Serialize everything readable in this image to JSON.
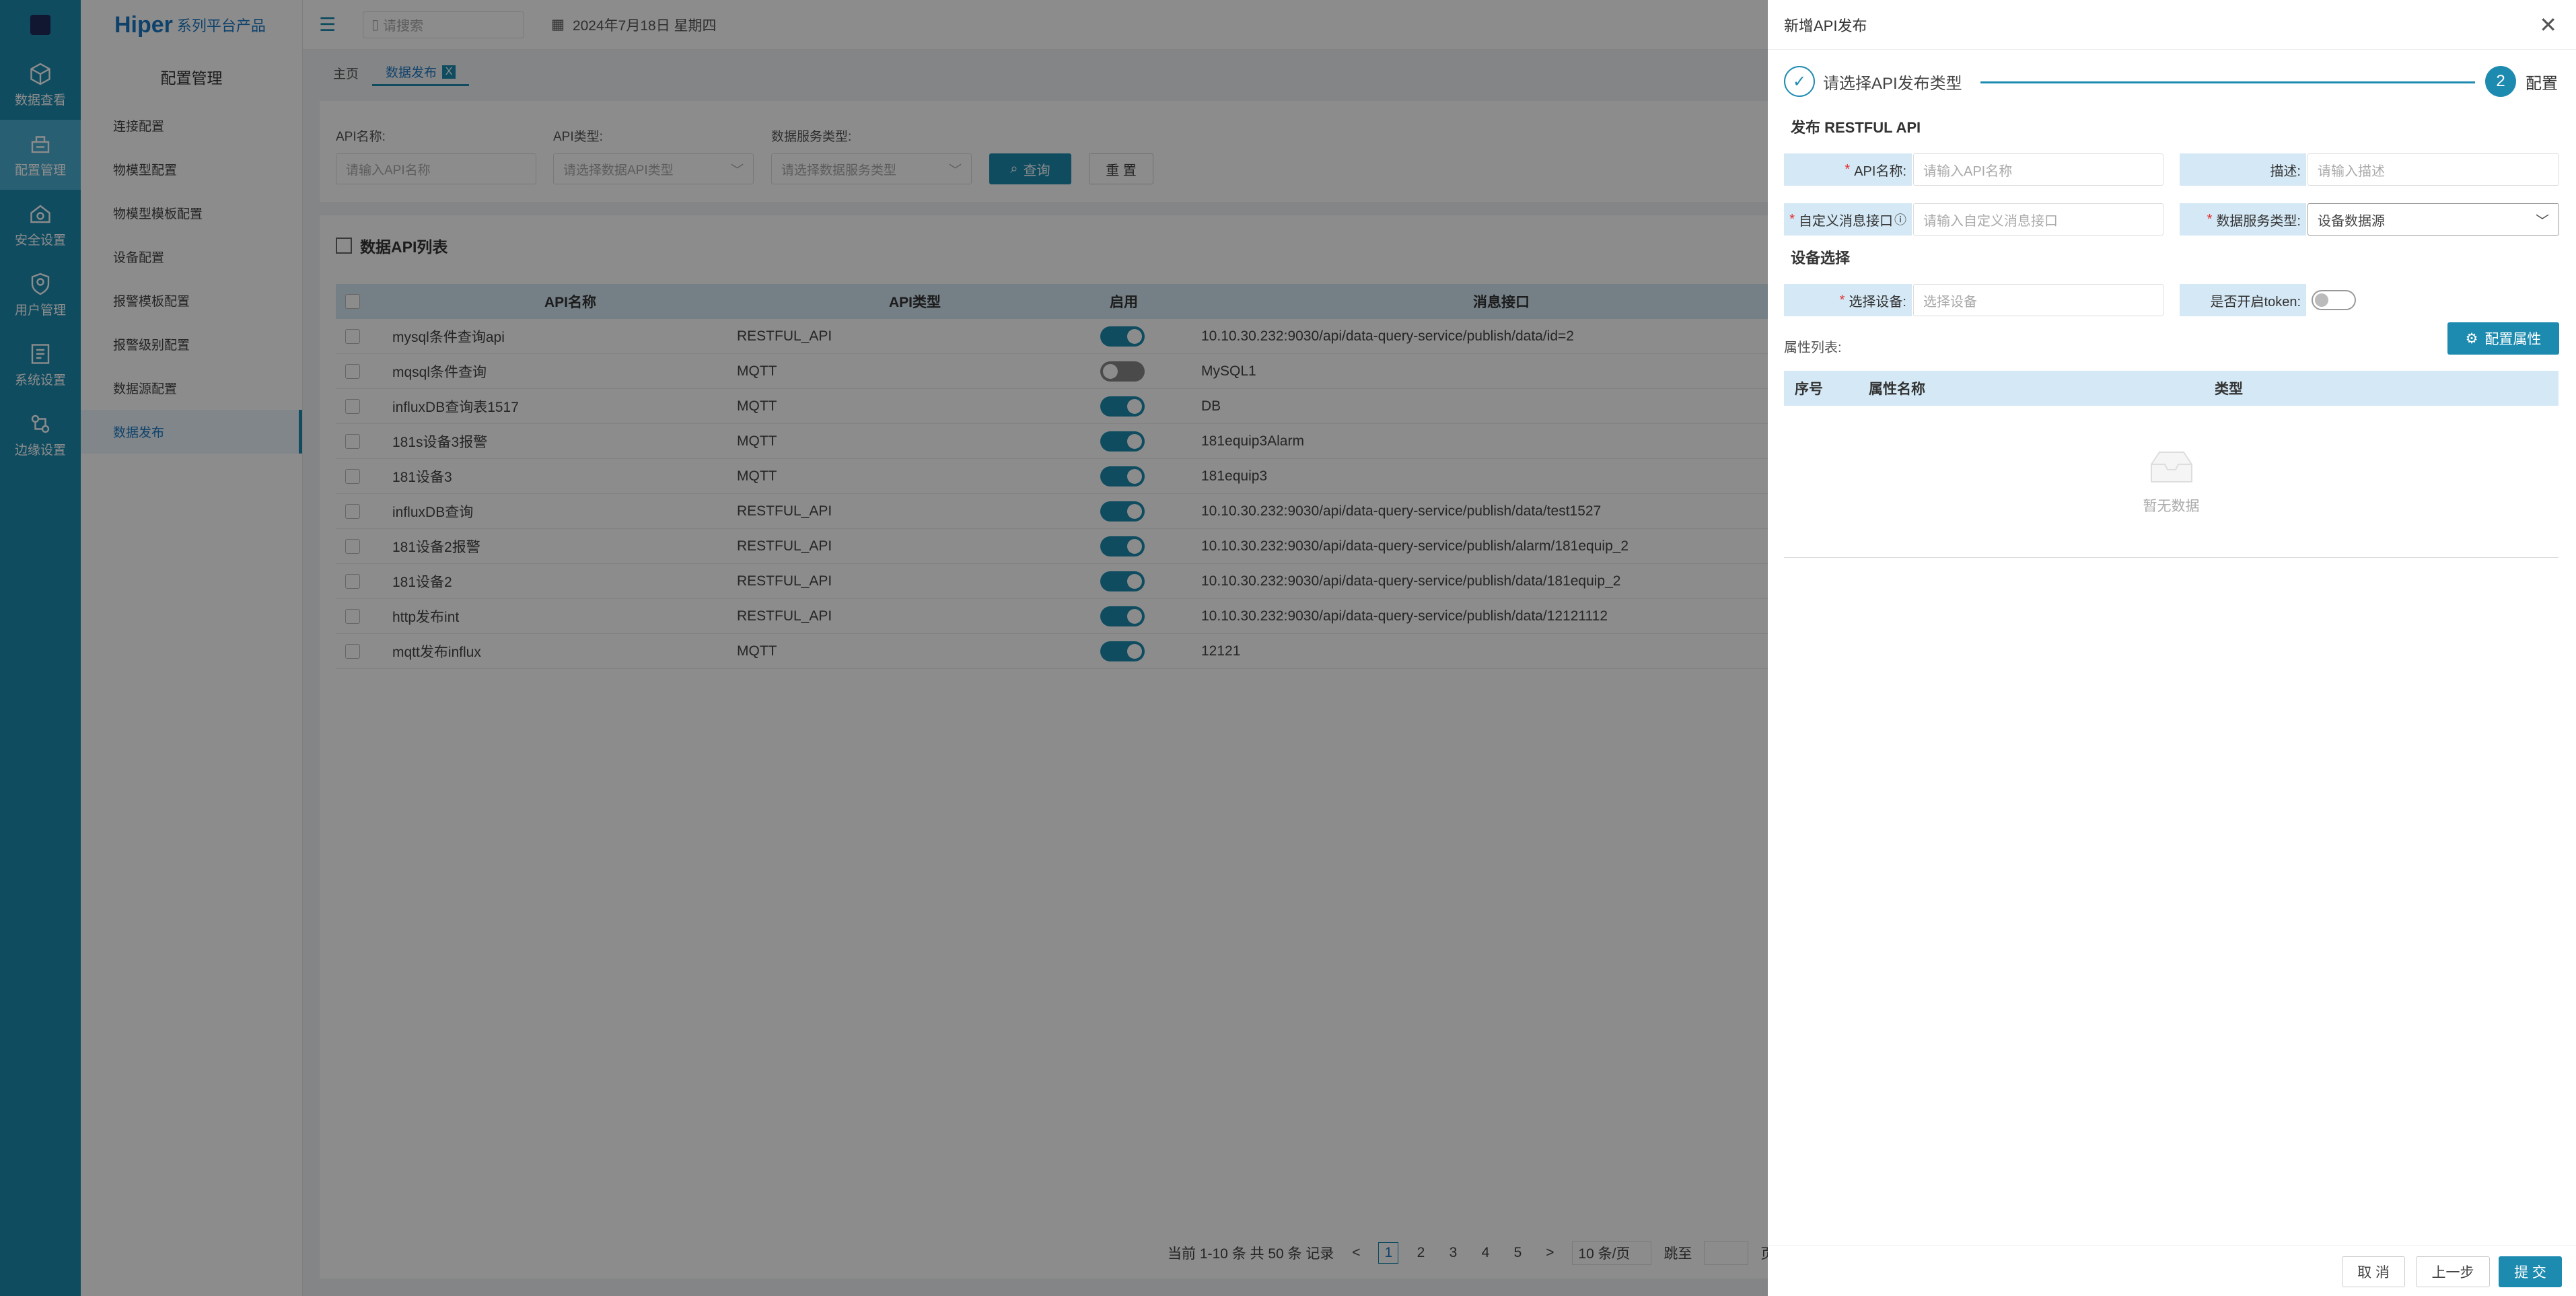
{
  "rail": {
    "items": [
      {
        "label": "数据查看",
        "icon": "cube-icon"
      },
      {
        "label": "配置管理",
        "icon": "config-icon"
      },
      {
        "label": "安全设置",
        "icon": "home-shield-icon"
      },
      {
        "label": "用户管理",
        "icon": "user-shield-icon"
      },
      {
        "label": "系统设置",
        "icon": "system-icon"
      },
      {
        "label": "边缘设置",
        "icon": "edge-icon"
      }
    ]
  },
  "brand": {
    "name": "Hiper",
    "sub": "系列平台产品"
  },
  "menu": {
    "title": "配置管理",
    "items": [
      "连接配置",
      "物模型配置",
      "物模型模板配置",
      "设备配置",
      "报警模板配置",
      "报警级别配置",
      "数据源配置",
      "数据发布"
    ]
  },
  "topbar": {
    "search_placeholder": "请搜索",
    "date": "2024年7月18日 星期四"
  },
  "tabs": {
    "home": "主页",
    "active": "数据发布",
    "close": "X"
  },
  "filter": {
    "api_name_label": "API名称:",
    "api_name_placeholder": "请输入API名称",
    "api_type_label": "API类型:",
    "api_type_placeholder": "请选择数据API类型",
    "service_label": "数据服务类型:",
    "service_placeholder": "请选择数据服务类型",
    "query": "查询",
    "reset": "重 置"
  },
  "list": {
    "title": "数据API列表",
    "headers": {
      "name": "API名称",
      "type": "API类型",
      "enabled": "启用",
      "endpoint": "消息接口"
    },
    "rows": [
      {
        "name": "mysql条件查询api",
        "type": "RESTFUL_API",
        "on": true,
        "endpoint": "10.10.30.232:9030/api/data-query-service/publish/data/id=2"
      },
      {
        "name": "mqsql条件查询",
        "type": "MQTT",
        "on": false,
        "endpoint": "MySQL1"
      },
      {
        "name": "influxDB查询表1517",
        "type": "MQTT",
        "on": true,
        "endpoint": "DB"
      },
      {
        "name": "181s设备3报警",
        "type": "MQTT",
        "on": true,
        "endpoint": "181equip3Alarm"
      },
      {
        "name": "181设备3",
        "type": "MQTT",
        "on": true,
        "endpoint": "181equip3"
      },
      {
        "name": "influxDB查询",
        "type": "RESTFUL_API",
        "on": true,
        "endpoint": "10.10.30.232:9030/api/data-query-service/publish/data/test1527"
      },
      {
        "name": "181设备2报警",
        "type": "RESTFUL_API",
        "on": true,
        "endpoint": "10.10.30.232:9030/api/data-query-service/publish/alarm/181equip_2"
      },
      {
        "name": "181设备2",
        "type": "RESTFUL_API",
        "on": true,
        "endpoint": "10.10.30.232:9030/api/data-query-service/publish/data/181equip_2"
      },
      {
        "name": "http发布int",
        "type": "RESTFUL_API",
        "on": true,
        "endpoint": "10.10.30.232:9030/api/data-query-service/publish/data/12121112"
      },
      {
        "name": "mqtt发布influx",
        "type": "MQTT",
        "on": true,
        "endpoint": "12121"
      }
    ]
  },
  "pager": {
    "summary": "当前 1-10 条 共 50 条 记录",
    "pages": [
      "1",
      "2",
      "3",
      "4",
      "5"
    ],
    "prev": "<",
    "next": ">",
    "size": "10 条/页",
    "jump": "跳至",
    "page_unit": "页"
  },
  "drawer": {
    "title": "新增API发布",
    "close": "✕",
    "step1": {
      "check": "✓",
      "label": "请选择API发布类型"
    },
    "step2": {
      "num": "2",
      "label": "配置"
    },
    "section1": "发布 RESTFUL API",
    "api_name_label": "API名称:",
    "api_name_placeholder": "请输入API名称",
    "desc_label": "描述:",
    "desc_placeholder": "请输入描述",
    "custom_label": "自定义消息接口",
    "custom_placeholder": "请输入自定义消息接口",
    "service_label": "数据服务类型:",
    "service_value": "设备数据源",
    "section2": "设备选择",
    "device_label": "选择设备:",
    "device_placeholder": "选择设备",
    "token_label": "是否开启token:",
    "config_btn": "配置属性",
    "props_label": "属性列表:",
    "props_headers": {
      "index": "序号",
      "name": "属性名称",
      "type": "类型"
    },
    "empty": "暂无数据",
    "cancel": "取 消",
    "prev": "上一步",
    "submit": "提 交",
    "required_mark": "*"
  }
}
